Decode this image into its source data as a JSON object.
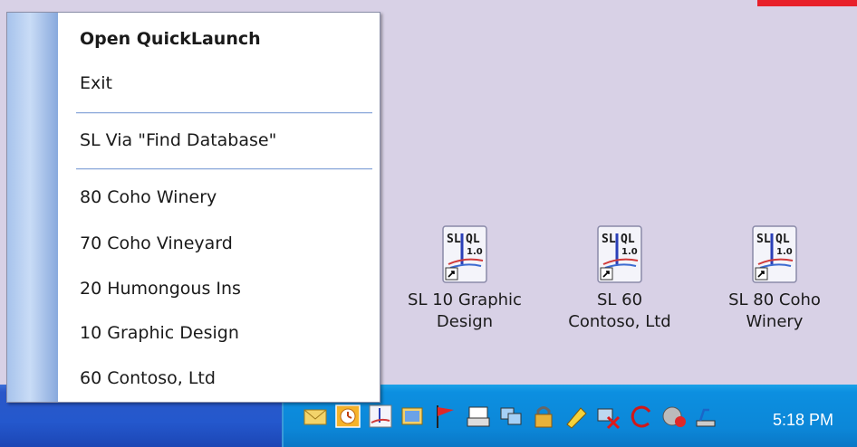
{
  "menu": {
    "items": [
      {
        "label": "Open QuickLaunch",
        "bold": true
      },
      {
        "label": "Exit"
      },
      {
        "label": "SL Via \"Find Database\""
      },
      {
        "label": "80 Coho Winery"
      },
      {
        "label": "70 Coho Vineyard"
      },
      {
        "label": "20 Humongous Ins"
      },
      {
        "label": "10 Graphic Design"
      },
      {
        "label": "60 Contoso, Ltd"
      }
    ]
  },
  "desktop_icons": [
    {
      "icon_text_top": "SL",
      "icon_text_right": "QL",
      "icon_version": "1.0",
      "line1": "SL 10 Graphic",
      "line2": "Design"
    },
    {
      "icon_text_top": "SL",
      "icon_text_right": "QL",
      "icon_version": "1.0",
      "line1": "SL 60",
      "line2": "Contoso, Ltd"
    },
    {
      "icon_text_top": "SL",
      "icon_text_right": "QL",
      "icon_version": "1.0",
      "line1": "SL 80 Coho",
      "line2": "Winery"
    }
  ],
  "taskbar": {
    "clock": "5:18 PM",
    "tray_icons": [
      "mail-icon",
      "clock-icon",
      "sl-ql-icon",
      "windows-icon",
      "red-flag-icon",
      "printer-icon",
      "network-icon",
      "lock-icon",
      "pencil-icon",
      "wireless-disconnected-icon",
      "refresh-icon",
      "antivirus-icon",
      "usb-icon"
    ]
  },
  "colors": {
    "desktop": "#d8d1e6",
    "menu_strip": "#a7c3ec",
    "taskbar": "#2458cd",
    "tray": "#0c8fe0"
  }
}
